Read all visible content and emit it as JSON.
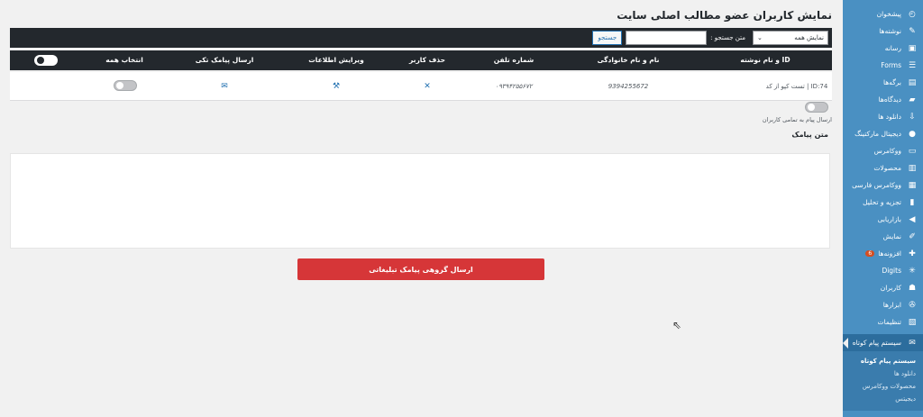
{
  "sidebar": {
    "items": [
      {
        "label": "پیشخوان",
        "icon": "dashboard-icon",
        "glyph": "◴"
      },
      {
        "label": "نوشته‌ها",
        "icon": "pin-icon",
        "glyph": "✎"
      },
      {
        "label": "رسانه",
        "icon": "media-icon",
        "glyph": "▣"
      },
      {
        "label": "Forms",
        "icon": "forms-icon",
        "glyph": "☰"
      },
      {
        "label": "برگه‌ها",
        "icon": "pages-icon",
        "glyph": "▤"
      },
      {
        "label": "دیدگاه‌ها",
        "icon": "comments-icon",
        "glyph": "▰"
      },
      {
        "label": "دانلود ها",
        "icon": "download-icon",
        "glyph": "⇩"
      },
      {
        "label": "دیجیتال مارکتینگ",
        "icon": "avatar-icon",
        "glyph": "●"
      },
      {
        "label": "ووکامرس",
        "icon": "woocommerce-icon",
        "glyph": "▭"
      },
      {
        "label": "محصولات",
        "icon": "products-icon",
        "glyph": "▥"
      },
      {
        "label": "ووکامرس فارسی",
        "icon": "persian-woo-icon",
        "glyph": "▦"
      },
      {
        "label": "تجزیه و تحلیل",
        "icon": "analytics-icon",
        "glyph": "▮"
      },
      {
        "label": "بازاریابی",
        "icon": "megaphone-icon",
        "glyph": "◀"
      },
      {
        "label": "نمایش",
        "icon": "appearance-icon",
        "glyph": "✐"
      },
      {
        "label": "افزونه‌ها",
        "icon": "plugins-icon",
        "glyph": "✚",
        "badge": "6"
      },
      {
        "label": "Digits",
        "icon": "digits-icon",
        "glyph": "✳"
      },
      {
        "label": "کاربران",
        "icon": "users-icon",
        "glyph": "☗"
      },
      {
        "label": "ابزارها",
        "icon": "tools-icon",
        "glyph": "✇"
      },
      {
        "label": "تنظیمات",
        "icon": "settings-icon",
        "glyph": "▧"
      }
    ],
    "active": {
      "label": "سیستم پیام کوتاه",
      "icon": "mail-icon",
      "glyph": "✉"
    },
    "submenu": [
      "سیستم پیام کوتاه",
      "دانلود ها",
      "محصولات ووکامرس",
      "دیجیتس"
    ]
  },
  "main": {
    "title": "نمایش کاربران عضو مطالب اصلی سایت",
    "filter": {
      "selected": "نمایش همه",
      "search_label": "متن جستجو :",
      "search_button": "جستجو"
    },
    "columns": [
      "ID و نام نوشته",
      "نام و نام خانوادگی",
      "شماره تلفن",
      "حذف کاربر",
      "ویرایش اطلاعات",
      "ارسال پیامک تکی",
      "انتخاب همه"
    ],
    "rows": [
      {
        "post": "ID:74 | تست کپو از کد",
        "name": "9394255672",
        "phone": "۰۹۳۹۴۲۵۵۶۷۲"
      }
    ],
    "send_all_label": "ارسال پیام به تمامی کاربران",
    "message_title": "متن پیامک",
    "send_button": "ارسال گروهی پیامک تبلیغاتی"
  },
  "colors": {
    "sidebar": "#4a90c2",
    "dark_bar": "#23282d",
    "button_red": "#d63638",
    "link_blue": "#2271b1"
  }
}
